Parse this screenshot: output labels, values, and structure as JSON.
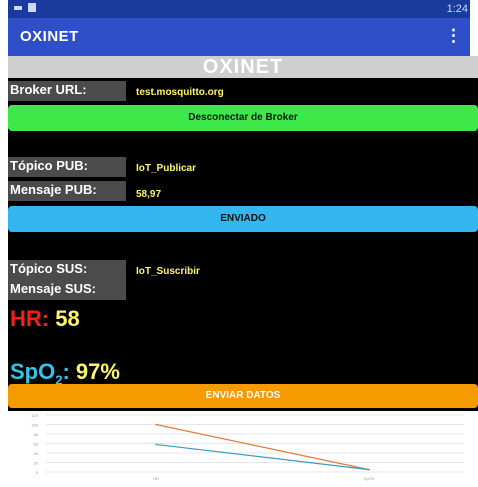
{
  "status": {
    "time": "1:24"
  },
  "appbar": {
    "title": "OXINET",
    "menu_glyph": "⋮"
  },
  "banner": "OXINET",
  "broker": {
    "label": "Broker URL:",
    "value": "test.mosquitto.org",
    "button": "Desconectar de Broker"
  },
  "pub": {
    "topic_label": "Tópico PUB:",
    "topic_value": "IoT_Publicar",
    "msg_label": "Mensaje PUB:",
    "msg_value": "58,97",
    "button": "ENVIADO"
  },
  "sus": {
    "topic_label": "Tópico SUS:",
    "topic_value": "IoT_Suscribir",
    "msg_label": "Mensaje SUS:"
  },
  "hr": {
    "label": "HR:",
    "value": "58"
  },
  "spo2": {
    "label_prefix": "SpO",
    "label_sub": "2",
    "label_suffix": ":",
    "value": "97%"
  },
  "send_button": "ENVIAR DATOS",
  "chart_data": {
    "type": "line",
    "categories": [
      "HR",
      "SpO2"
    ],
    "series": [
      {
        "values": [
          100,
          5
        ],
        "color": "#e07b39"
      },
      {
        "values": [
          58,
          5
        ],
        "color": "#3a9cc8"
      }
    ],
    "ylim": [
      0,
      120
    ],
    "y_ticks": [
      0,
      20,
      40,
      60,
      80,
      100,
      120
    ],
    "grid": true
  },
  "colors": {
    "status_bar": "#1a3a9e",
    "app_bar": "#2f4fc9",
    "green": "#3fe84a",
    "blue": "#33b5f0",
    "orange": "#f59b00"
  }
}
